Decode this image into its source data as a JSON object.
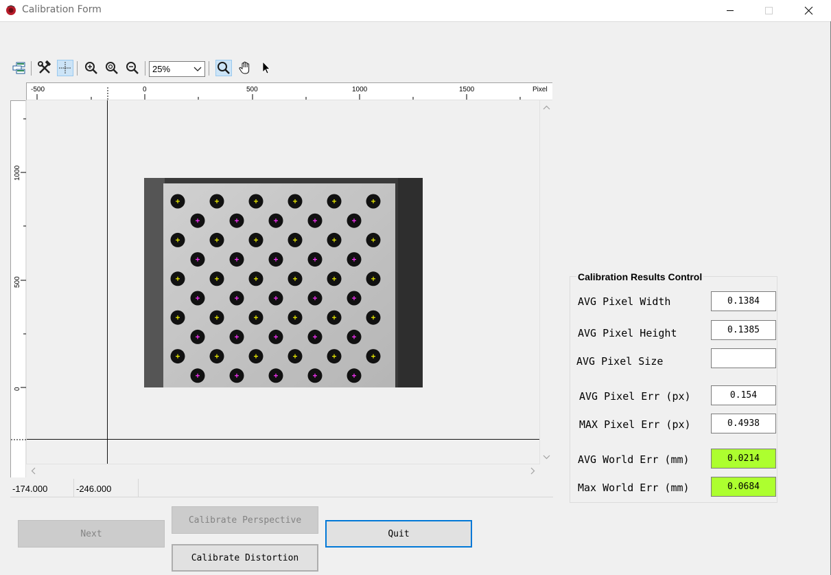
{
  "window": {
    "title": "Calibration Form",
    "colors": {
      "app_icon": "#b81c2a",
      "accent": "#0078d7"
    }
  },
  "toolbar": {
    "icons": [
      "layers-icon",
      "tools-icon",
      "crosshair-icon",
      "zoom-in-icon",
      "zoom-fit-icon",
      "zoom-out-icon",
      "zoom-tool-icon",
      "pan-hand-icon",
      "pointer-icon"
    ],
    "zoom": {
      "selected": "25%"
    }
  },
  "ruler": {
    "horizontal_labels": [
      "-500",
      "0",
      "500",
      "1000",
      "1500",
      "Pixel"
    ],
    "vertical_labels": [
      "1000",
      "500",
      "0"
    ]
  },
  "status": {
    "x": "-174.000",
    "y": "-246.000"
  },
  "buttons": {
    "next": "Next",
    "calibrate_perspective": "Calibrate Perspective",
    "quit": "Quit",
    "calibrate_distortion": "Calibrate Distortion"
  },
  "results": {
    "title": "Calibration Results Control",
    "avg_pixel_width": {
      "label": "AVG Pixel Width",
      "value": "0.1384"
    },
    "avg_pixel_height": {
      "label": "AVG Pixel Height",
      "value": "0.1385"
    },
    "avg_pixel_size": {
      "label": "AVG Pixel Size",
      "value": ""
    },
    "avg_pixel_err": {
      "label": "AVG Pixel Err (px)",
      "value": "0.154"
    },
    "max_pixel_err": {
      "label": "MAX Pixel Err (px)",
      "value": "0.4938"
    },
    "avg_world_err": {
      "label": "AVG World Err (mm)",
      "value": "0.0214"
    },
    "max_world_err": {
      "label": "Max World Err (mm)",
      "value": "0.0684"
    },
    "highlight_color": "#adff2f"
  }
}
